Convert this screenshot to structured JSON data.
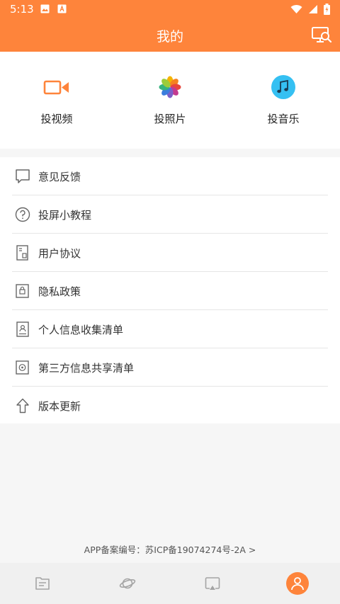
{
  "status_bar": {
    "time": "5:13"
  },
  "header": {
    "title": "我的",
    "cast_icon": "screen-search-icon"
  },
  "quick_actions": [
    {
      "label": "投视频",
      "icon": "video-camera-icon",
      "color": "#fe843b"
    },
    {
      "label": "投照片",
      "icon": "photos-flower-icon",
      "color": "#f5a623"
    },
    {
      "label": "投音乐",
      "icon": "music-note-icon",
      "color": "#35c0f2"
    }
  ],
  "menu": {
    "items": [
      {
        "label": "意见反馈",
        "icon": "feedback-bubble-icon"
      },
      {
        "label": "投屏小教程",
        "icon": "question-circle-icon"
      },
      {
        "label": "用户协议",
        "icon": "agreement-document-icon"
      },
      {
        "label": "隐私政策",
        "icon": "privacy-lock-icon"
      },
      {
        "label": "个人信息收集清单",
        "icon": "personal-info-icon"
      },
      {
        "label": "第三方信息共享清单",
        "icon": "share-list-icon"
      },
      {
        "label": "版本更新",
        "icon": "upload-arrow-icon"
      }
    ]
  },
  "footer": {
    "record_text": "APP备案编号：苏ICP备19074274号-2A >"
  },
  "tab_bar": {
    "tabs": [
      {
        "icon": "files-icon"
      },
      {
        "icon": "planet-icon"
      },
      {
        "icon": "cast-screen-icon"
      },
      {
        "icon": "profile-icon",
        "active": true
      }
    ]
  },
  "colors": {
    "accent": "#fe843b",
    "background": "#f6f6f6"
  }
}
